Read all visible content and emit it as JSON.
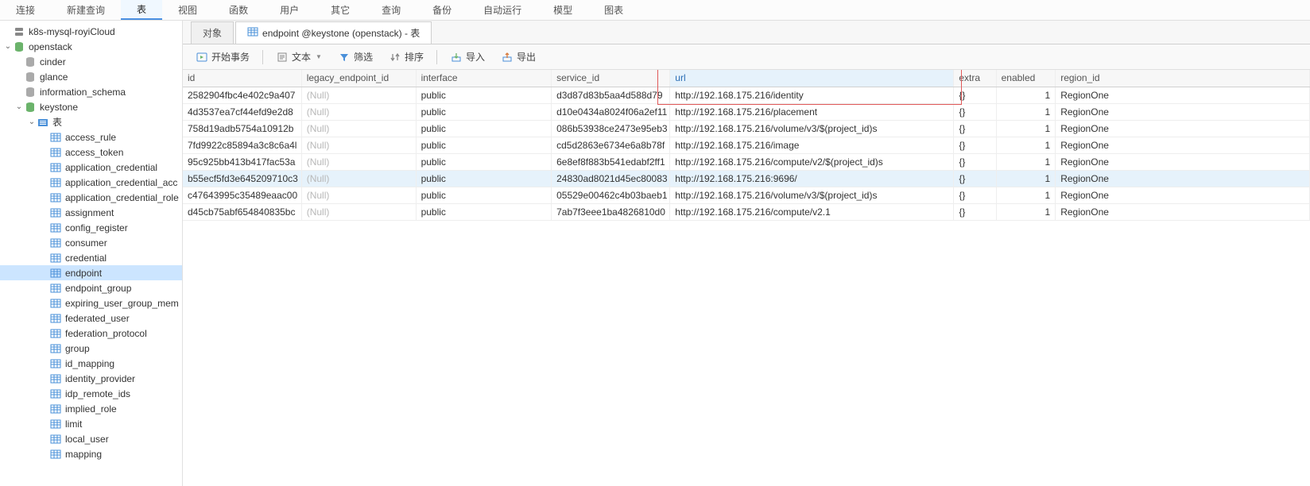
{
  "menubar": [
    "连接",
    "新建查询",
    "表",
    "视图",
    "函数",
    "用户",
    "其它",
    "查询",
    "备份",
    "自动运行",
    "模型",
    "图表"
  ],
  "menubar_active_index": 2,
  "tree": {
    "connections": [
      {
        "label": "k8s-mysql-royiCloud",
        "type": "server"
      },
      {
        "label": "openstack",
        "type": "db",
        "expanded": true,
        "children": [
          {
            "label": "cinder",
            "type": "db-gray"
          },
          {
            "label": "glance",
            "type": "db-gray"
          },
          {
            "label": "information_schema",
            "type": "db-gray"
          },
          {
            "label": "keystone",
            "type": "db",
            "expanded": true,
            "children": [
              {
                "label": "表",
                "type": "folder",
                "expanded": true,
                "children": [
                  {
                    "label": "access_rule",
                    "type": "table"
                  },
                  {
                    "label": "access_token",
                    "type": "table"
                  },
                  {
                    "label": "application_credential",
                    "type": "table"
                  },
                  {
                    "label": "application_credential_acc",
                    "type": "table"
                  },
                  {
                    "label": "application_credential_role",
                    "type": "table"
                  },
                  {
                    "label": "assignment",
                    "type": "table"
                  },
                  {
                    "label": "config_register",
                    "type": "table"
                  },
                  {
                    "label": "consumer",
                    "type": "table"
                  },
                  {
                    "label": "credential",
                    "type": "table"
                  },
                  {
                    "label": "endpoint",
                    "type": "table",
                    "selected": true
                  },
                  {
                    "label": "endpoint_group",
                    "type": "table"
                  },
                  {
                    "label": "expiring_user_group_mem",
                    "type": "table"
                  },
                  {
                    "label": "federated_user",
                    "type": "table"
                  },
                  {
                    "label": "federation_protocol",
                    "type": "table"
                  },
                  {
                    "label": "group",
                    "type": "table"
                  },
                  {
                    "label": "id_mapping",
                    "type": "table"
                  },
                  {
                    "label": "identity_provider",
                    "type": "table"
                  },
                  {
                    "label": "idp_remote_ids",
                    "type": "table"
                  },
                  {
                    "label": "implied_role",
                    "type": "table"
                  },
                  {
                    "label": "limit",
                    "type": "table"
                  },
                  {
                    "label": "local_user",
                    "type": "table"
                  },
                  {
                    "label": "mapping",
                    "type": "table"
                  }
                ]
              }
            ]
          }
        ]
      }
    ]
  },
  "tabs": [
    {
      "label": "对象",
      "active": false
    },
    {
      "label": "endpoint @keystone (openstack) - 表",
      "active": true
    }
  ],
  "toolbar": {
    "begin_tx": "开始事务",
    "text": "文本",
    "filter": "筛选",
    "sort": "排序",
    "import": "导入",
    "export": "导出"
  },
  "grid": {
    "columns": [
      "id",
      "legacy_endpoint_id",
      "interface",
      "service_id",
      "url",
      "extra",
      "enabled",
      "region_id"
    ],
    "highlight_col_index": 4,
    "highlight_row_index": 5,
    "rows": [
      {
        "id": "2582904fbc4e402c9a407",
        "legacy": "(Null)",
        "interface": "public",
        "service": "d3d87d83b5aa4d588d79",
        "url": "http://192.168.175.216/identity",
        "extra": "{}",
        "enabled": "1",
        "region": "RegionOne"
      },
      {
        "id": "4d3537ea7cf44efd9e2d8",
        "legacy": "(Null)",
        "interface": "public",
        "service": "d10e0434a8024f06a2ef11",
        "url": "http://192.168.175.216/placement",
        "extra": "{}",
        "enabled": "1",
        "region": "RegionOne"
      },
      {
        "id": "758d19adb5754a10912b",
        "legacy": "(Null)",
        "interface": "public",
        "service": "086b53938ce2473e95eb3",
        "url": "http://192.168.175.216/volume/v3/$(project_id)s",
        "extra": "{}",
        "enabled": "1",
        "region": "RegionOne"
      },
      {
        "id": "7fd9922c85894a3c8c6a4l",
        "legacy": "(Null)",
        "interface": "public",
        "service": "cd5d2863e6734e6a8b78f",
        "url": "http://192.168.175.216/image",
        "extra": "{}",
        "enabled": "1",
        "region": "RegionOne"
      },
      {
        "id": "95c925bb413b417fac53a",
        "legacy": "(Null)",
        "interface": "public",
        "service": "6e8ef8f883b541edabf2ff1",
        "url": "http://192.168.175.216/compute/v2/$(project_id)s",
        "extra": "{}",
        "enabled": "1",
        "region": "RegionOne"
      },
      {
        "id": "b55ecf5fd3e645209710c3",
        "legacy": "(Null)",
        "interface": "public",
        "service": "24830ad8021d45ec80083",
        "url": "http://192.168.175.216:9696/",
        "extra": "{}",
        "enabled": "1",
        "region": "RegionOne"
      },
      {
        "id": "c47643995c35489eaac00",
        "legacy": "(Null)",
        "interface": "public",
        "service": "05529e00462c4b03baeb1",
        "url": "http://192.168.175.216/volume/v3/$(project_id)s",
        "extra": "{}",
        "enabled": "1",
        "region": "RegionOne"
      },
      {
        "id": "d45cb75abf654840835bc",
        "legacy": "(Null)",
        "interface": "public",
        "service": "7ab7f3eee1ba4826810d0",
        "url": "http://192.168.175.216/compute/v2.1",
        "extra": "{}",
        "enabled": "1",
        "region": "RegionOne"
      }
    ]
  }
}
